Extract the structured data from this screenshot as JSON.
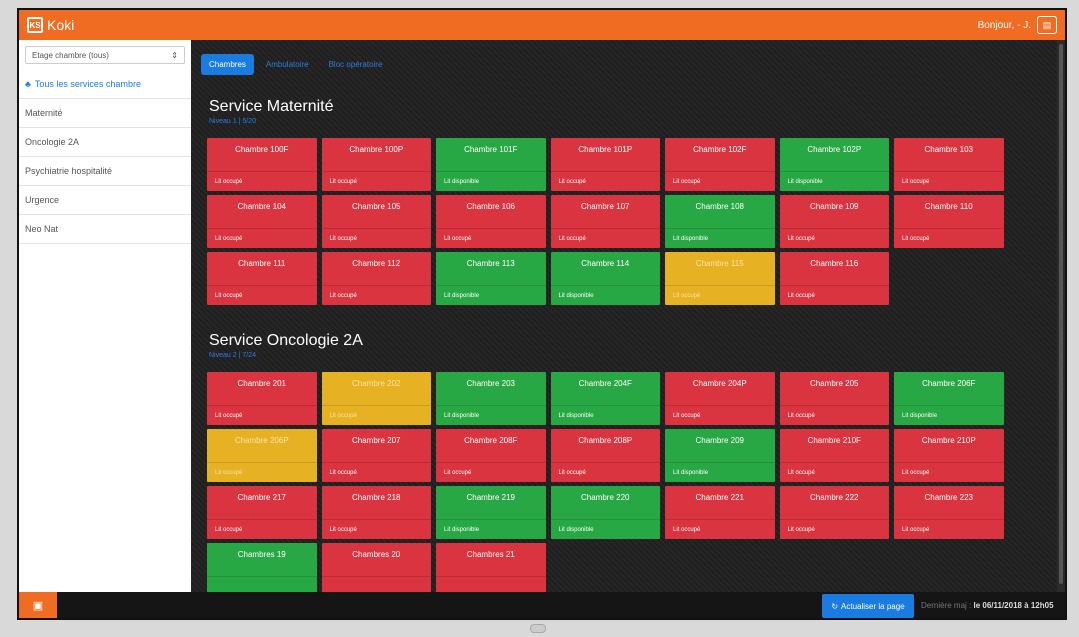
{
  "app": {
    "title": "Koki",
    "logo": "KS",
    "greeting": "Bonjour, - J."
  },
  "sidebar": {
    "filter": "Etage chambre (tous)",
    "all_services": "Tous les services chambre",
    "items": [
      "Maternité",
      "Oncologie 2A",
      "Psychiatrie hospitalité",
      "Urgence",
      "Neo Nat"
    ]
  },
  "tabs": [
    "Chambres",
    "Ambulatoire",
    "Bloc opératoire"
  ],
  "services": [
    {
      "title": "Service Maternité",
      "sub": "Niveau 1 | 5/20",
      "rooms": [
        {
          "name": "Chambre 100F",
          "status": "Lit occupé",
          "state": "occ"
        },
        {
          "name": "Chambre 100P",
          "status": "Lit occupé",
          "state": "occ"
        },
        {
          "name": "Chambre 101F",
          "status": "Lit disponible",
          "state": "free"
        },
        {
          "name": "Chambre 101P",
          "status": "Lit occupé",
          "state": "occ"
        },
        {
          "name": "Chambre 102F",
          "status": "Lit occupé",
          "state": "occ"
        },
        {
          "name": "Chambre 102P",
          "status": "Lit disponible",
          "state": "free"
        },
        {
          "name": "Chambre 103",
          "status": "Lit occupé",
          "state": "occ"
        },
        {
          "name": "Chambre 104",
          "status": "Lit occupé",
          "state": "occ"
        },
        {
          "name": "Chambre 105",
          "status": "Lit occupé",
          "state": "occ"
        },
        {
          "name": "Chambre 106",
          "status": "Lit occupé",
          "state": "occ"
        },
        {
          "name": "Chambre 107",
          "status": "Lit occupé",
          "state": "occ"
        },
        {
          "name": "Chambre 108",
          "status": "Lit disponible",
          "state": "free"
        },
        {
          "name": "Chambre 109",
          "status": "Lit occupé",
          "state": "occ"
        },
        {
          "name": "Chambre 110",
          "status": "Lit occupé",
          "state": "occ"
        },
        {
          "name": "Chambre 111",
          "status": "Lit occupé",
          "state": "occ"
        },
        {
          "name": "Chambre 112",
          "status": "Lit occupé",
          "state": "occ"
        },
        {
          "name": "Chambre 113",
          "status": "Lit disponible",
          "state": "free"
        },
        {
          "name": "Chambre 114",
          "status": "Lit disponible",
          "state": "free"
        },
        {
          "name": "Chambre 115",
          "status": "Lit occupé",
          "state": "busy"
        },
        {
          "name": "Chambre 116",
          "status": "Lit occupé",
          "state": "occ"
        }
      ]
    },
    {
      "title": "Service Oncologie 2A",
      "sub": "Niveau 2 | 7/24",
      "rooms": [
        {
          "name": "Chambre 201",
          "status": "Lit occupé",
          "state": "occ"
        },
        {
          "name": "Chambre 202",
          "status": "Lit occupé",
          "state": "busy"
        },
        {
          "name": "Chambre 203",
          "status": "Lit disponible",
          "state": "free"
        },
        {
          "name": "Chambre 204F",
          "status": "Lit disponible",
          "state": "free"
        },
        {
          "name": "Chambre 204P",
          "status": "Lit occupé",
          "state": "occ"
        },
        {
          "name": "Chambre 205",
          "status": "Lit occupé",
          "state": "occ"
        },
        {
          "name": "Chambre 206F",
          "status": "Lit disponible",
          "state": "free"
        },
        {
          "name": "Chambre 206P",
          "status": "Lit occupé",
          "state": "busy"
        },
        {
          "name": "Chambre 207",
          "status": "Lit occupé",
          "state": "occ"
        },
        {
          "name": "Chambre 208F",
          "status": "Lit occupé",
          "state": "occ"
        },
        {
          "name": "Chambre 208P",
          "status": "Lit occupé",
          "state": "occ"
        },
        {
          "name": "Chambre 209",
          "status": "Lit disponible",
          "state": "free"
        },
        {
          "name": "Chambre 210F",
          "status": "Lit occupé",
          "state": "occ"
        },
        {
          "name": "Chambre 210P",
          "status": "Lit occupé",
          "state": "occ"
        },
        {
          "name": "Chambre 217",
          "status": "Lit occupé",
          "state": "occ"
        },
        {
          "name": "Chambre 218",
          "status": "Lit occupé",
          "state": "occ"
        },
        {
          "name": "Chambre 219",
          "status": "Lit disponible",
          "state": "free"
        },
        {
          "name": "Chambre 220",
          "status": "Lit disponible",
          "state": "free"
        },
        {
          "name": "Chambre 221",
          "status": "Lit occupé",
          "state": "occ"
        },
        {
          "name": "Chambre 222",
          "status": "Lit occupé",
          "state": "occ"
        },
        {
          "name": "Chambre 223",
          "status": "Lit occupé",
          "state": "occ"
        },
        {
          "name": "Chambres 19",
          "status": "",
          "state": "free"
        },
        {
          "name": "Chambres 20",
          "status": "",
          "state": "occ"
        },
        {
          "name": "Chambres 21",
          "status": "",
          "state": "occ"
        }
      ]
    }
  ],
  "footer": {
    "refresh": "Actualiser la page",
    "last_label": "Dernière maj : ",
    "last_value": "le 06/11/2018 à 12h05"
  },
  "colors": {
    "accent": "#ef6c22",
    "occupied": "#d9343f",
    "available": "#28a745",
    "pending": "#e6b123",
    "link": "#1a7be0"
  }
}
